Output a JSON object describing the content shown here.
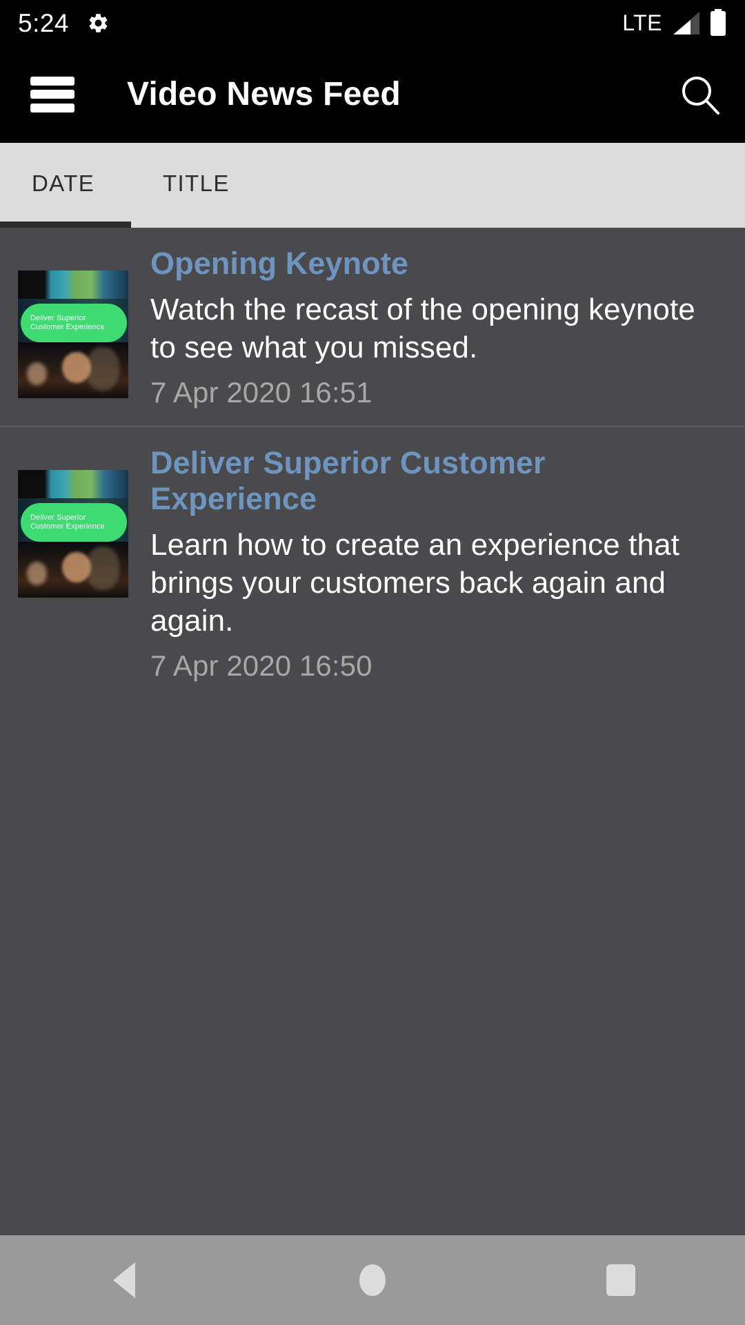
{
  "status_bar": {
    "time": "5:24",
    "gear_icon": "gear-icon",
    "network_label": "LTE",
    "signal_icon": "signal-bars-icon",
    "battery_icon": "battery-full-icon"
  },
  "app_bar": {
    "menu_icon": "hamburger-menu-icon",
    "title": "Video News Feed",
    "search_icon": "search-icon"
  },
  "tabs": {
    "items": [
      {
        "label": "DATE",
        "selected": true
      },
      {
        "label": "TITLE",
        "selected": false
      }
    ],
    "indicator_color": "#2b2b2b",
    "background": "#dcdcdc"
  },
  "feed": {
    "items": [
      {
        "title": "Opening Keynote",
        "description": "Watch the recast of the opening keynote to see what you missed.",
        "date": "7 Apr 2020 16:51",
        "thumbnail": {
          "overlay_line1": "Deliver Superior",
          "overlay_line2": "Customer Experience",
          "overlay_color": "#3ddb72"
        }
      },
      {
        "title": "Deliver Superior Customer Experience",
        "description": "Learn how to create an experience that brings your customers back again and again.",
        "date": "7 Apr 2020 16:50",
        "thumbnail": {
          "overlay_line1": "Deliver Superior",
          "overlay_line2": "Customer Experience",
          "overlay_color": "#3ddb72"
        }
      }
    ],
    "background": "#4a4a4c",
    "title_color": "#6d95c0",
    "date_color": "#a8a8a8"
  },
  "nav_bar": {
    "back_icon": "back-triangle-icon",
    "home_icon": "home-circle-icon",
    "recents_icon": "recents-square-icon",
    "background": "#9a9a9a"
  }
}
